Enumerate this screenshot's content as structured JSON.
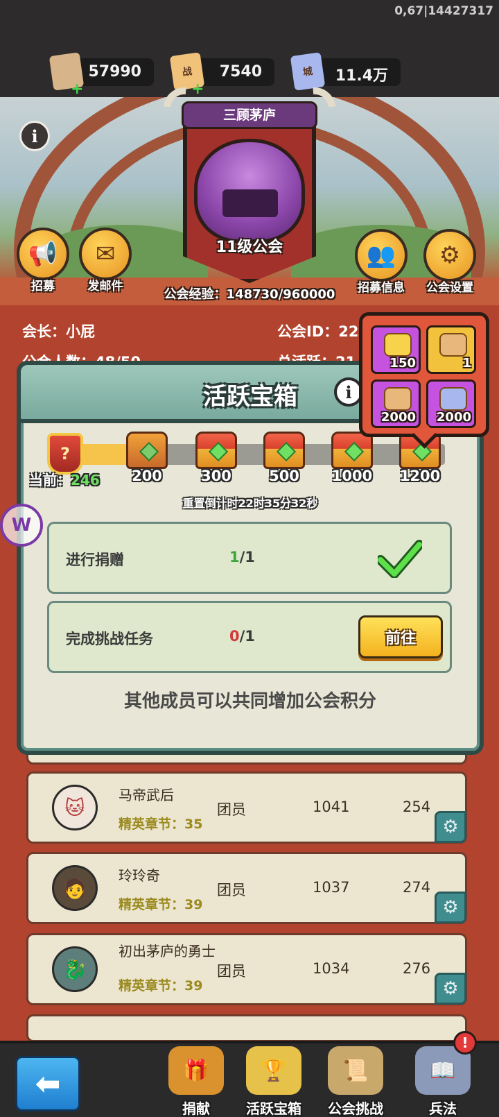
{
  "status": {
    "fps_text": "0,67|14427317"
  },
  "resources": [
    {
      "name": "scroll",
      "value": "57990",
      "has_plus": true,
      "color": "#d8b48a"
    },
    {
      "name": "battle-token",
      "value": "7540",
      "has_plus": true,
      "color": "#f0c27a",
      "glyph": "战"
    },
    {
      "name": "city-token",
      "value": "11.4万",
      "has_plus": false,
      "color": "#a8b8ee",
      "glyph": "城"
    }
  ],
  "guild": {
    "banner_title": "三顾茅庐",
    "level_label": "11级公会",
    "exp_text": "公会经验：148730/960000",
    "leader_text": "会长：小屁",
    "id_text": "公会ID：22",
    "members_text": "公会人数：48/50",
    "activity_text": "总活跃：21"
  },
  "actions": {
    "recruit": "招募",
    "mail": "发邮件",
    "recruit_info": "招募信息",
    "guild_settings": "公会设置"
  },
  "modal": {
    "title": "活跃宝箱",
    "current_label": "当前：",
    "current_value": "246",
    "current_badge_glyph": "?",
    "progress_fraction": 0.19,
    "thresholds": [
      "200",
      "300",
      "500",
      "1000",
      "1200"
    ],
    "reset_text": "重置倒计时22时35分32秒",
    "tasks": [
      {
        "label": "进行捐赠",
        "done": "1",
        "total": "/1",
        "completed": true
      },
      {
        "label": "完成挑战任务",
        "done": "0",
        "total": "/1",
        "completed": false,
        "button": "前往"
      }
    ],
    "footer": "其他成员可以共同增加公会积分"
  },
  "reward_popup": {
    "items": [
      {
        "name": "gold-ingot",
        "qty": "150"
      },
      {
        "name": "mystery-book",
        "qty": "1"
      },
      {
        "name": "battle-token",
        "qty": "2000"
      },
      {
        "name": "city-token",
        "qty": "2000"
      }
    ]
  },
  "members": [
    {
      "name": "马帝武后",
      "sub": "精英章节：35",
      "role": "团员",
      "value1": "1041",
      "value2": "254"
    },
    {
      "name": "玲玲奇",
      "sub": "精英章节：39",
      "role": "团员",
      "value1": "1037",
      "value2": "274"
    },
    {
      "name": "初出茅庐的勇士",
      "sub": "精英章节：39",
      "role": "团员",
      "value1": "1034",
      "value2": "276"
    }
  ],
  "bottom_nav": {
    "items": [
      "捐献",
      "活跃宝箱",
      "公会挑战",
      "兵法"
    ],
    "alert": "!"
  }
}
